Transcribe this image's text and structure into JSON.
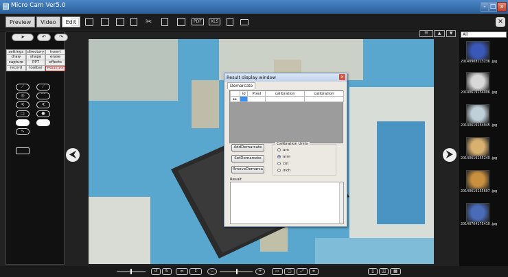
{
  "window": {
    "title": "Micro Cam Ver5.0",
    "controls": [
      "-",
      "□",
      "x"
    ]
  },
  "toolbar": {
    "tabs": [
      {
        "label": "Preview",
        "active": false
      },
      {
        "label": "Video",
        "active": false
      },
      {
        "label": "Edit",
        "active": true
      }
    ],
    "icons": [
      "open-folder-icon",
      "folder-icon",
      "save-icon",
      "save-as-icon",
      "document-icon",
      "cut-icon",
      "copy-icon",
      "print-icon",
      "pdf-export-icon",
      "xls-export-icon",
      "trash-icon",
      "mail-icon"
    ],
    "text_icons": [
      "PDF",
      "XLS"
    ],
    "settings_icon": "tools-icon"
  },
  "left_panel": {
    "toggle_icons": [
      "cursor-icon",
      "undo-icon",
      "redo-icon"
    ],
    "menu_rows": [
      [
        "settings",
        "directory",
        "insert"
      ],
      [
        "draw",
        "shape",
        "erase"
      ],
      [
        "capture",
        "PPT",
        "effects"
      ],
      [
        "record",
        "toolbar",
        "measure"
      ]
    ],
    "active_menu": "measure",
    "tools": [
      "line-measure-icon",
      "angle-measure-icon",
      "circle-measure-icon",
      "arc-measure-icon",
      "triangle-angle-icon",
      "angle2-icon",
      "rectangle-icon",
      "circle-fill-icon",
      "ellipse-outline-icon",
      "ellipse-fill-icon",
      "polyline-icon",
      "scale-bar-icon"
    ]
  },
  "viewer": {
    "prev_icon": "arrow-left-icon",
    "next_icon": "arrow-right-icon",
    "prev_glyph": "⮜",
    "next_glyph": "⮞"
  },
  "dialog": {
    "title": "Result display window",
    "tab": "Demarcate",
    "columns": [
      "",
      "id",
      "Pixel",
      "calibration",
      "calibration"
    ],
    "row_marker": "▸▸",
    "buttons": [
      "AddDemarcate",
      "SetDemarcate",
      "RmoveDemarca"
    ],
    "calibration_units": {
      "label": "Calibration Units",
      "options": [
        "um",
        "mm",
        "cm",
        "inch"
      ],
      "selected": "mm"
    },
    "result_label": "Result"
  },
  "gallery": {
    "search_value": "All",
    "view_icons": [
      "list-view-icon",
      "thumbnail-view-icon",
      "sort-icon"
    ],
    "items": [
      {
        "label": "20140908113236 .jpg",
        "color": "#3a58b8"
      },
      {
        "label": "20140619154006 .jpg",
        "color": "#d8d8d8"
      },
      {
        "label": "20140619154945 .jpg",
        "color": "#c0d0d8"
      },
      {
        "label": "20140619155240 .jpg",
        "color": "#d8b070"
      },
      {
        "label": "20140619155607 .jpg",
        "color": "#c89040"
      },
      {
        "label": "20140704175410 .jpg",
        "color": "#4a6cb8"
      }
    ]
  },
  "bottom_bar": {
    "controls": [
      "zoom-slider",
      "rotate-left-icon",
      "rotate-right-icon",
      "flip-horizontal-icon",
      "flip-vertical-icon",
      "zoom-out-icon",
      "brightness-slider",
      "zoom-in-icon",
      "fit-icon",
      "actual-size-icon",
      "fullscreen-icon",
      "crop-icon",
      "layout-single-icon",
      "layout-double-icon",
      "layout-grid-icon"
    ]
  },
  "colors": {
    "titlebar": "#3d77b8",
    "accent_red": "#e02020",
    "selected_cell": "#3a8ef0"
  }
}
